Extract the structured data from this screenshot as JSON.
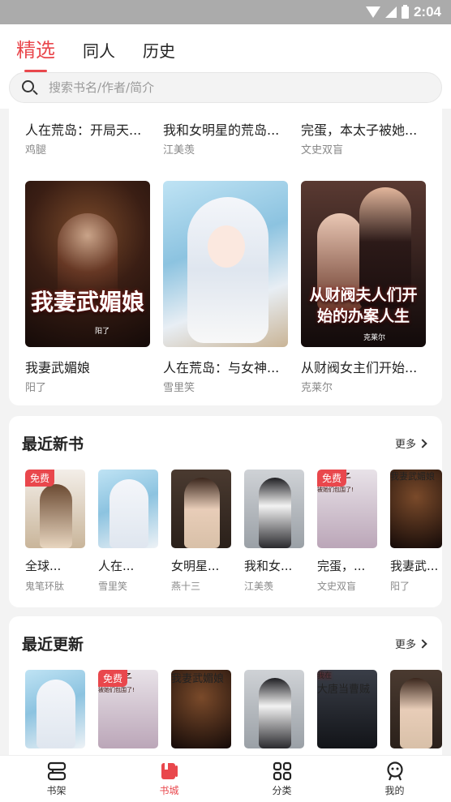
{
  "status_bar": {
    "time": "2:04"
  },
  "tabs": [
    {
      "label": "精选",
      "active": true
    },
    {
      "label": "同人",
      "active": false
    },
    {
      "label": "历史",
      "active": false
    }
  ],
  "search": {
    "placeholder": "搜索书名/作者/简介"
  },
  "featured": {
    "row1": [
      {
        "title": "人在荒岛：开局天...",
        "author": "鸡腿"
      },
      {
        "title": "我和女明星的荒岛...",
        "author": "江美羡"
      },
      {
        "title": "完蛋，本太子被她...",
        "author": "文史双盲"
      }
    ],
    "row2": [
      {
        "title": "我妻武媚娘",
        "author": "阳了",
        "cover_text": "我妻武媚娘",
        "cover_mark": "阳了"
      },
      {
        "title": "人在荒岛：与女神...",
        "author": "雪里笑",
        "cover_text": "",
        "cover_mark": ""
      },
      {
        "title": "从财阀女主们开始...",
        "author": "克莱尔",
        "cover_text": "从财阀夫人们开始的办案人生",
        "cover_mark": "克莱尔"
      }
    ]
  },
  "recent_new": {
    "title": "最近新书",
    "more": "更多",
    "free_label": "免费",
    "books": [
      {
        "title": "全球...",
        "author": "鬼笔环肽",
        "free": true
      },
      {
        "title": "人在...",
        "author": "雪里笑",
        "free": false
      },
      {
        "title": "女明星...",
        "author": "燕十三",
        "free": false
      },
      {
        "title": "我和女...",
        "author": "江美羡",
        "free": false
      },
      {
        "title": "完蛋，...",
        "author": "文史双盲",
        "free": true,
        "cover_text": "本太子",
        "cover_sub": "被她们包围了!"
      },
      {
        "title": "我妻武...",
        "author": "阳了",
        "free": false,
        "cover_text": "我妻武媚娘"
      }
    ]
  },
  "recent_updated": {
    "title": "最近更新",
    "more": "更多",
    "free_label": "免费",
    "books": [
      {
        "free": false
      },
      {
        "free": true,
        "cover_text": "本太子",
        "cover_sub": "被她们包围了!"
      },
      {
        "free": false,
        "cover_text": "我妻武媚娘"
      },
      {
        "free": false
      },
      {
        "free": false,
        "cover_text": "大唐当曹贼",
        "cover_top": "我在"
      },
      {
        "free": false
      }
    ]
  },
  "bottom_nav": [
    {
      "label": "书架",
      "icon": "bookshelf-icon",
      "active": false
    },
    {
      "label": "书城",
      "icon": "bookstore-icon",
      "active": true
    },
    {
      "label": "分类",
      "icon": "category-icon",
      "active": false
    },
    {
      "label": "我的",
      "icon": "profile-icon",
      "active": false
    }
  ],
  "colors": {
    "accent": "#e9474c",
    "text": "#222222",
    "muted": "#888888",
    "background": "#f3f3f3"
  }
}
